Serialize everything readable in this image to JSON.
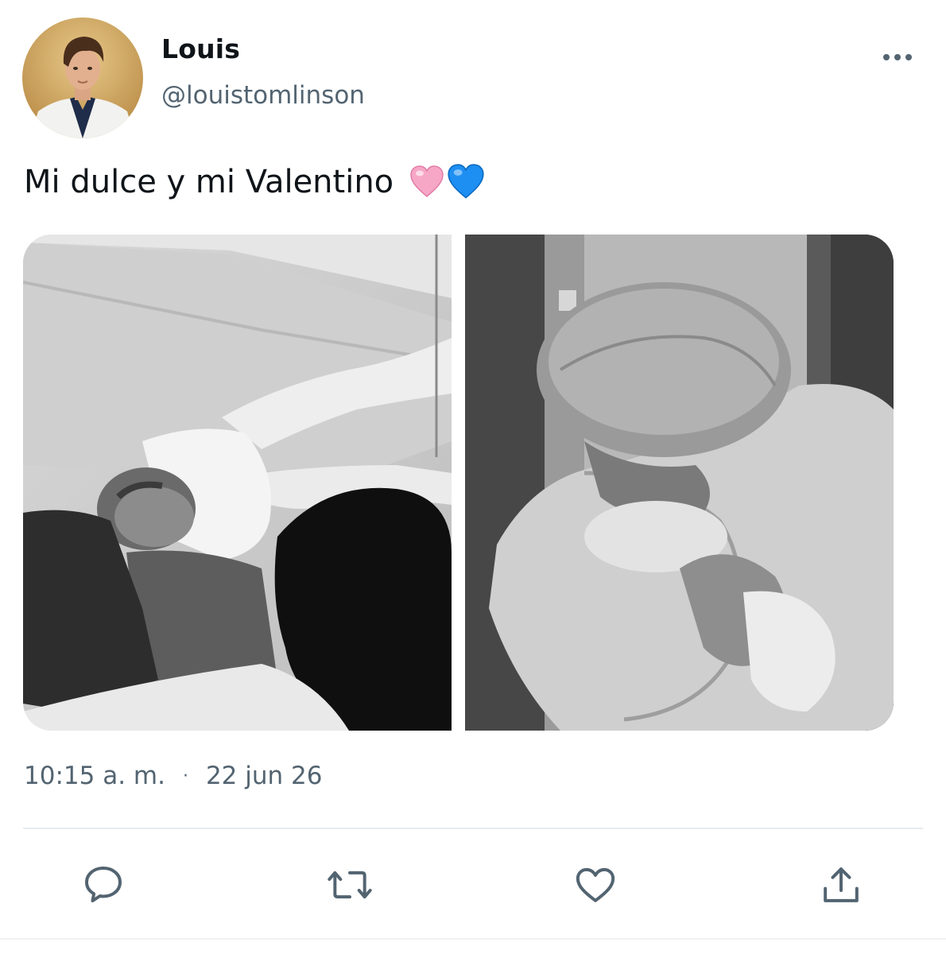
{
  "user": {
    "display_name": "Louis",
    "handle": "@louistomlinson",
    "avatar_icon": "avatar-photo"
  },
  "menu": {
    "more_icon": "more-horizontal-icon"
  },
  "tweet": {
    "text": "Mi dulce y mi Valentino",
    "emoji": [
      "pink-heart",
      "blue-heart"
    ],
    "time": "10:15 a. m.",
    "separator": "·",
    "date": "22 jun 26"
  },
  "media": {
    "count": 2
  },
  "actions": {
    "icons": [
      "reply-icon",
      "retweet-icon",
      "like-icon",
      "share-icon"
    ]
  },
  "colors": {
    "text_primary": "#0f1419",
    "text_secondary": "#536471",
    "divider": "#e6ecf0",
    "pink_heart": "#f7a7c6",
    "blue_heart": "#1d8ff2"
  }
}
